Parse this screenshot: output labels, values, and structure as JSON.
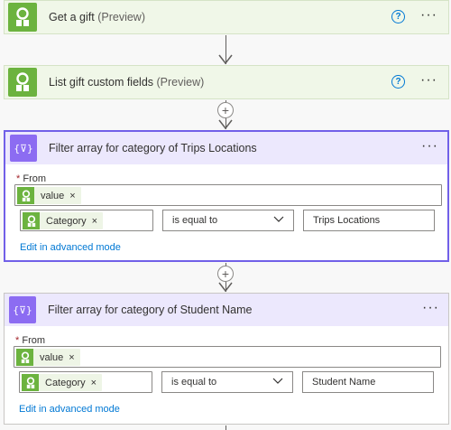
{
  "steps": [
    {
      "title": "Get a gift",
      "suffix": "(Preview)"
    },
    {
      "title": "List gift custom fields",
      "suffix": "(Preview)"
    }
  ],
  "filters": [
    {
      "title": "Filter array for category of Trips Locations",
      "from_label": "From",
      "from_token": "value",
      "left_token": "Category",
      "operator": "is equal to",
      "right_value": "Trips Locations",
      "advanced_link": "Edit in advanced mode"
    },
    {
      "title": "Filter array for category of Student Name",
      "from_label": "From",
      "from_token": "value",
      "left_token": "Category",
      "operator": "is equal to",
      "right_value": "Student Name",
      "advanced_link": "Edit in advanced mode"
    }
  ],
  "icons": {
    "help": "?",
    "more": "···",
    "remove": "×",
    "add": "+",
    "filter_glyph": "{⊽}"
  },
  "colors": {
    "connector_green": "#6cb33f",
    "filter_purple": "#8c6cf2",
    "selected_border": "#7160e8",
    "link_blue": "#0078d4"
  }
}
